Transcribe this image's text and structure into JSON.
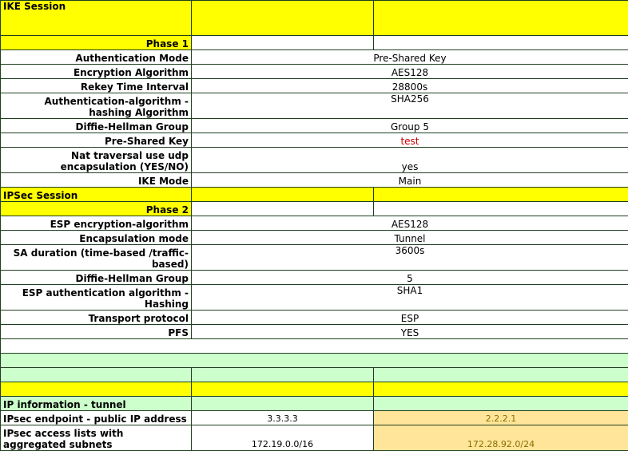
{
  "ike": {
    "title": "IKE Session",
    "phase_label": "Phase 1",
    "rows": [
      {
        "label": "Authentication Mode",
        "value": "Pre-Shared Key"
      },
      {
        "label": "Encryption Algorithm",
        "value": "AES128"
      },
      {
        "label": "Rekey Time Interval",
        "value": "28800s"
      },
      {
        "label": "Authentication-algorithm - hashing Algorithm",
        "value": "SHA256"
      },
      {
        "label": "Diffie-Hellman Group",
        "value": "Group 5"
      },
      {
        "label": "Pre-Shared Key",
        "value": "test"
      },
      {
        "label": "Nat traversal use udp encapsulation (YES/NO)",
        "value": "yes"
      },
      {
        "label": "IKE Mode",
        "value": "Main"
      }
    ]
  },
  "ipsec": {
    "title": "IPSec Session",
    "phase_label": "Phase 2",
    "rows": [
      {
        "label": "ESP encryption-algorithm",
        "value": "AES128"
      },
      {
        "label": "Encapsulation mode",
        "value": "Tunnel"
      },
      {
        "label": "SA duration (time-based /traffic-based)",
        "value": "3600s"
      },
      {
        "label": "Diffie-Hellman Group",
        "value": "5"
      },
      {
        "label": "ESP authentication algorithm - Hashing",
        "value": "SHA1"
      },
      {
        "label": "Transport protocol",
        "value": "ESP"
      },
      {
        "label": "PFS",
        "value": "YES"
      }
    ]
  },
  "ip_info": {
    "title": "IP information - tunnel",
    "endpoint": {
      "label": "IPsec endpoint - public IP address",
      "local": "3.3.3.3",
      "remote": "2.2.2.1"
    },
    "acl": {
      "label": "IPsec access lists with aggregated subnets",
      "local": "172.19.0.0/16",
      "remote": "172.28.92.0/24"
    }
  },
  "colors": {
    "section_yellow": "#ffff00",
    "section_green": "#ccffcc",
    "remote_tan": "#ffe599",
    "psk_red": "#cc0000"
  }
}
